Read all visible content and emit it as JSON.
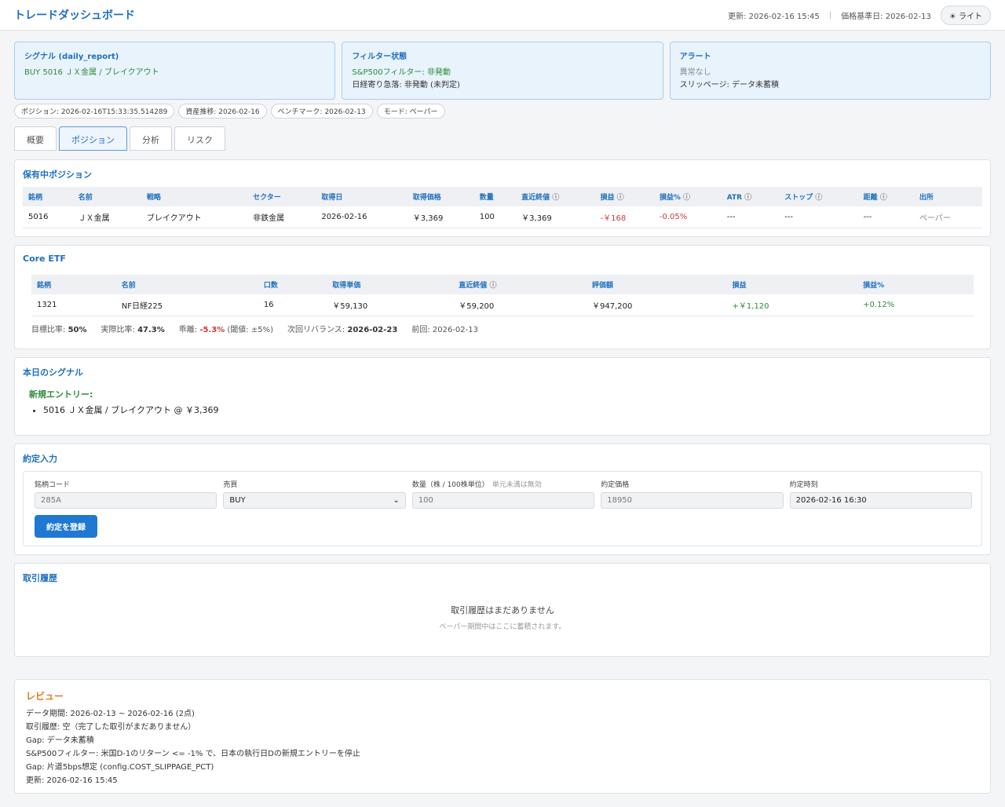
{
  "header": {
    "title": "トレードダッシュボード",
    "updated": "更新: 2026-02-16 15:45",
    "price_date": "価格基準日: 2026-02-13",
    "theme_label": "☀ ライト"
  },
  "cards": {
    "signal": {
      "title": "シグナル (daily_report)",
      "line1": "BUY 5016 ＪＸ金属 / ブレイクアウト"
    },
    "filter": {
      "title": "フィルター状態",
      "line1": "S&P500フィルター: 非発動",
      "line2": "日経寄り急落: 非発動 (未判定)"
    },
    "alert": {
      "title": "アラート",
      "line1": "異常なし",
      "line2": "スリッページ: データ未蓄積"
    }
  },
  "pills": [
    "ポジション: 2026-02-16T15:33:35.514289",
    "資産推移: 2026-02-16",
    "ベンチマーク: 2026-02-13",
    "モード: ペーパー"
  ],
  "tabs": [
    "概要",
    "ポジション",
    "分析",
    "リスク"
  ],
  "positions": {
    "title": "保有中ポジション",
    "headers": [
      "銘柄",
      "名前",
      "戦略",
      "セクター",
      "取得日",
      "取得価格",
      "数量",
      "直近終値",
      "損益",
      "損益%",
      "ATR",
      "ストップ",
      "距離",
      "出所"
    ],
    "row": [
      "5016",
      "ＪＸ金属",
      "ブレイクアウト",
      "非鉄金属",
      "2026-02-16",
      "￥3,369",
      "100",
      "￥3,369",
      "-￥168",
      "-0.05%",
      "---",
      "---",
      "---",
      "ペーパー"
    ]
  },
  "etf": {
    "title": "Core ETF",
    "headers": [
      "銘柄",
      "名前",
      "口数",
      "取得単価",
      "直近終値",
      "評価額",
      "損益",
      "損益%"
    ],
    "row": [
      "1321",
      "NF日経225",
      "16",
      "￥59,130",
      "￥59,200",
      "￥947,200",
      "+￥1,120",
      "+0.12%"
    ],
    "target_label": "目標比率:",
    "target": "50%",
    "actual_label": "実際比率:",
    "actual": "47.3%",
    "dev_label": "乖離:",
    "dev": "-5.3%",
    "dev_note": "(閾値: ±5%)",
    "next_label": "次回リバランス:",
    "next": "2026-02-23",
    "prev": "前回: 2026-02-13"
  },
  "signals": {
    "title": "本日のシグナル",
    "sub": "新規エントリー:",
    "item": "5016 ＪＸ金属 / ブレイクアウト @ ￥3,369"
  },
  "order": {
    "title": "約定入力",
    "code_label": "銘柄コード",
    "code_placeholder": "285A",
    "side_label": "売買",
    "side_value": "BUY",
    "qty_label": "数量（株 / 100株単位）",
    "qty_hint": "単元未満は無効",
    "qty_placeholder": "100",
    "price_label": "約定価格",
    "price_placeholder": "18950",
    "time_label": "約定時刻",
    "time_value": "2026-02-16 16:30",
    "submit": "約定を登録"
  },
  "history": {
    "title": "取引履歴",
    "empty": "取引履歴はまだありません",
    "empty_sub": "ペーパー期間中はここに蓄積されます。"
  },
  "review": {
    "title": "レビュー",
    "lines": [
      "データ期間: 2026-02-13 ~ 2026-02-16 (2点)",
      "取引履歴: 空（完了した取引がまだありません）",
      "Gap: データ未蓄積",
      "S&P500フィルター: 米国D-1のリターン <= -1% で、日本の執行日Dの新規エントリーを停止",
      "Gap: 片道5bps想定 (config.COST_SLIPPAGE_PCT)",
      "更新: 2026-02-16 15:45"
    ]
  }
}
